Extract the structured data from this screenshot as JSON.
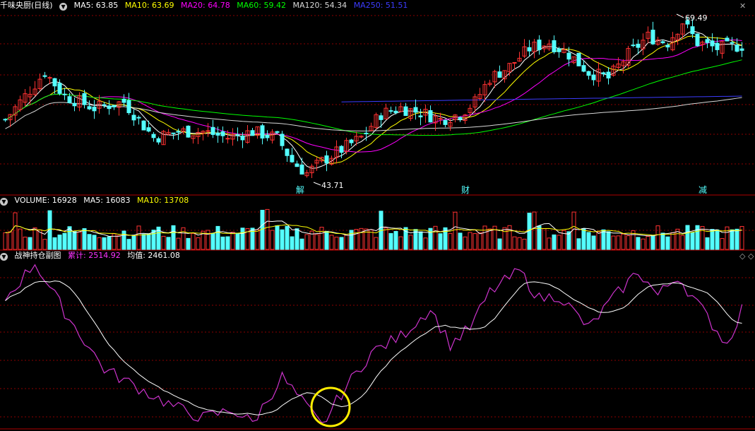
{
  "main_header": {
    "title": "千味央厨(日线)",
    "ma5": "MA5: 63.85",
    "ma10": "MA10: 63.69",
    "ma20": "MA20: 64.78",
    "ma60": "MA60: 59.42",
    "ma120": "MA120: 54.34",
    "ma250": "MA250: 51.51"
  },
  "volume_header": {
    "volume": "VOLUME: 16928",
    "ma5": "MA5: 16083",
    "ma10": "MA10: 13708"
  },
  "indicator_header": {
    "name": "战神持仓副图",
    "cum": "累计: 2514.92",
    "avg": "均值: 2461.08"
  },
  "annotations": {
    "high": "69.49",
    "low": "43.71",
    "marker_1": "解",
    "marker_2": "财",
    "marker_3": "减"
  },
  "corner_icons": [
    "x-icon",
    "diamond-icon"
  ],
  "colors": {
    "up": "#ff3232",
    "down": "#54ffff",
    "ma5": "#ffffff",
    "ma10": "#ffff00",
    "ma20": "#ff00ff",
    "ma60": "#00ff00",
    "ma120": "#d8d8d8",
    "ma250": "#3c3cff",
    "grid": "#8b0000",
    "circle": "#ffee00"
  },
  "chart_data": {
    "type": "candlestick",
    "price_range": [
      43.71,
      69.49
    ],
    "price_ticks": [
      45,
      50,
      55,
      60,
      65,
      70
    ]
  }
}
